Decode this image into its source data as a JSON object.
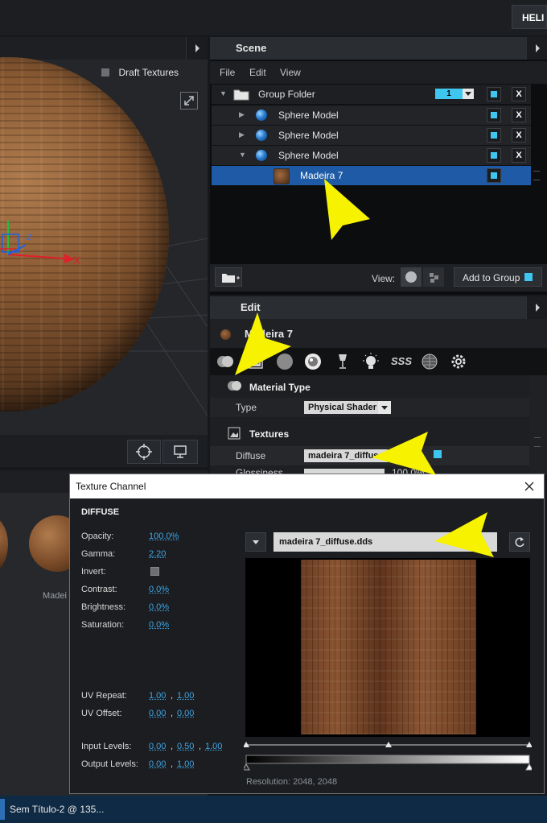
{
  "topbar": {
    "help_label": "HELI"
  },
  "viewport": {
    "draft_textures_label": "Draft Textures",
    "axis_x_label": "X",
    "axis_z_label": "Z",
    "material_label": "Madei"
  },
  "scene": {
    "title": "Scene",
    "menu": [
      "File",
      "Edit",
      "View"
    ],
    "group_folder": {
      "label": "Group Folder",
      "count": "1"
    },
    "items": [
      {
        "label": "Sphere Model"
      },
      {
        "label": "Sphere Model"
      },
      {
        "label": "Sphere Model"
      }
    ],
    "selected_material": "Madeira 7",
    "view_label": "View:",
    "add_to_group_label": "Add to Group"
  },
  "edit": {
    "title": "Edit",
    "material_name": "Madeira 7",
    "material_type_heading": "Material Type",
    "type_label": "Type",
    "type_value": "Physical Shader",
    "textures_heading": "Textures",
    "diffuse_label": "Diffuse",
    "diffuse_value": "madeira 7_diffuse",
    "glossiness_label": "Glossiness",
    "glossiness_pct": "100.0%",
    "sss_label": "SSS"
  },
  "dialog": {
    "title": "Texture Channel",
    "heading": "DIFFUSE",
    "opacity_label": "Opacity:",
    "opacity_value": "100.0%",
    "gamma_label": "Gamma:",
    "gamma_value": "2.20",
    "invert_label": "Invert:",
    "contrast_label": "Contrast:",
    "contrast_value": "0.0%",
    "brightness_label": "Brightness:",
    "brightness_value": "0.0%",
    "saturation_label": "Saturation:",
    "saturation_value": "0.0%",
    "uv_repeat_label": "UV Repeat:",
    "uv_repeat_u": "1.00",
    "uv_repeat_v": "1.00",
    "uv_offset_label": "UV Offset:",
    "uv_offset_u": "0.00",
    "uv_offset_v": "0.00",
    "input_levels_label": "Input Levels:",
    "input_levels": [
      "0.00",
      "0.50",
      "1.00"
    ],
    "output_levels_label": "Output Levels:",
    "output_levels": [
      "0.00",
      "1.00"
    ],
    "comma": ",",
    "filename": "madeira 7_diffuse.dds",
    "resolution": "Resolution: 2048, 2048"
  },
  "taskbar": {
    "app_label": "Sem Título-2 @ 135..."
  },
  "colors": {
    "accent": "#3fc6f0",
    "selection": "#1e5aa6",
    "arrow": "#f7f200",
    "link": "#3fa6e6"
  }
}
